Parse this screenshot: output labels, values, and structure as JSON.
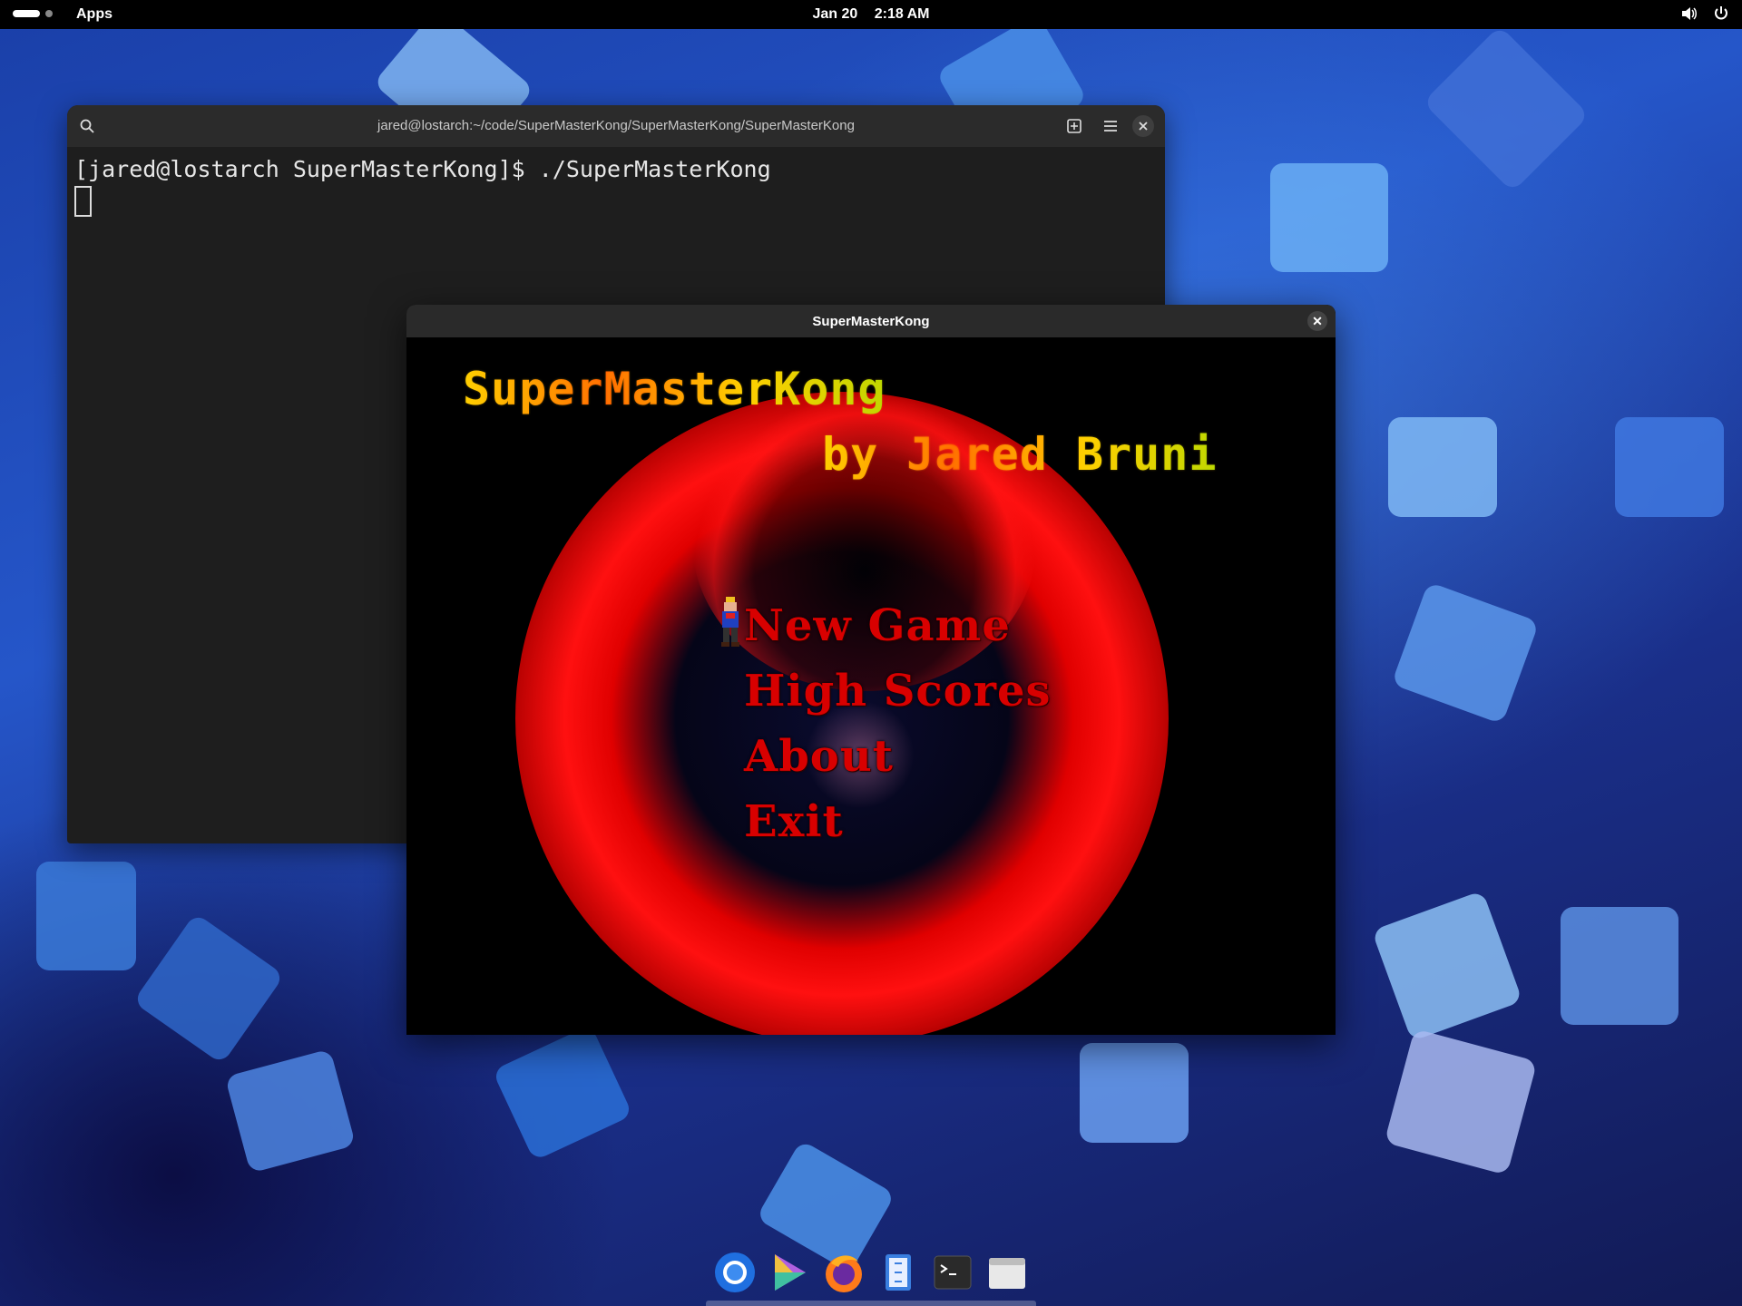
{
  "topbar": {
    "activities_label": "Apps",
    "date": "Jan 20",
    "time": "2:18 AM",
    "tray_icons": [
      "volume-icon",
      "power-icon"
    ]
  },
  "terminal": {
    "title": "jared@lostarch:~/code/SuperMasterKong/SuperMasterKong/SuperMasterKong",
    "prompt_line": "[jared@lostarch SuperMasterKong]$ ./SuperMasterKong",
    "header_icons": [
      "search-icon",
      "new-tab-icon",
      "menu-icon",
      "close-icon"
    ]
  },
  "game_window": {
    "title": "SuperMasterKong",
    "game_title": "SuperMasterKong",
    "byline": "by Jared Bruni",
    "menu": [
      "New Game",
      "High Scores",
      "About",
      "Exit"
    ],
    "selected_index": 0
  },
  "dock": {
    "apps": [
      "chromium-icon",
      "media-player-icon",
      "firefox-icon",
      "files-icon",
      "terminal-icon",
      "window-icon"
    ]
  },
  "colors": {
    "menu_red": "#d80000",
    "ring_red": "#ff1010",
    "terminal_bg": "#1e1e1e",
    "topbar_bg": "#000000"
  }
}
